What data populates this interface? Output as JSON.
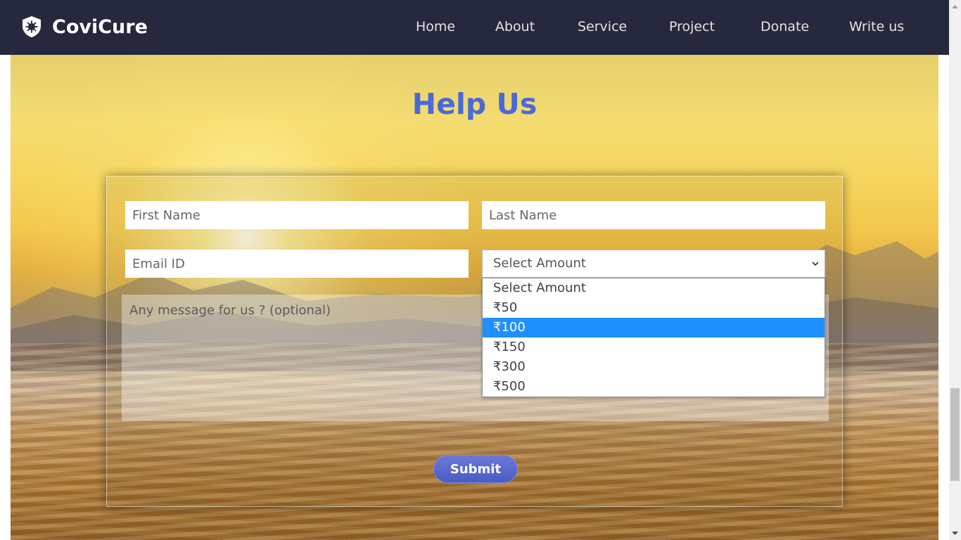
{
  "brand": {
    "name": "CoviCure",
    "logo_icon": "shield-virus-icon"
  },
  "nav": {
    "items": [
      {
        "label": "Home"
      },
      {
        "label": "About"
      },
      {
        "label": "Service"
      },
      {
        "label": "Project"
      },
      {
        "label": "Donate"
      },
      {
        "label": "Write us"
      }
    ]
  },
  "page": {
    "heading": "Help Us"
  },
  "form": {
    "first_name": {
      "placeholder": "First Name",
      "value": ""
    },
    "last_name": {
      "placeholder": "Last Name",
      "value": ""
    },
    "email": {
      "placeholder": "Email ID",
      "value": ""
    },
    "amount": {
      "selected_label": "Select Amount",
      "highlighted_option": "₹100",
      "options": [
        {
          "label": "Select Amount"
        },
        {
          "label": "₹50"
        },
        {
          "label": "₹100"
        },
        {
          "label": "₹150"
        },
        {
          "label": "₹300"
        },
        {
          "label": "₹500"
        }
      ]
    },
    "message": {
      "placeholder": "Any message for us ? (optional)",
      "value": ""
    },
    "submit_label": "Submit"
  },
  "colors": {
    "navbar_bg": "#26283d",
    "heading": "#4a69d8",
    "option_highlight": "#1e90ff",
    "submit_button": "#5868cf"
  }
}
